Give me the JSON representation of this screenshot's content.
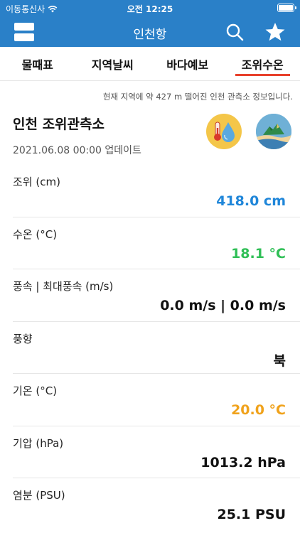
{
  "status_bar": {
    "carrier": "이동통신사",
    "time": "오전 12:25"
  },
  "nav": {
    "title": "인천항"
  },
  "tabs": [
    {
      "label": "물때표",
      "active": false
    },
    {
      "label": "지역날씨",
      "active": false
    },
    {
      "label": "바다예보",
      "active": false
    },
    {
      "label": "조위수온",
      "active": true
    }
  ],
  "notice": "현재 지역에 약 427 m 떨어진 인천 관측소 정보입니다.",
  "station": {
    "name": "인천 조위관측소",
    "updated": "2021.06.08 00:00 업데이트"
  },
  "rows": [
    {
      "label": "조위 (cm)",
      "value": "418.0 cm",
      "color": "#1f86d9"
    },
    {
      "label": "수온 (°C)",
      "value": "18.1 °C",
      "color": "#2fbf56"
    },
    {
      "label": "풍속 | 최대풍속 (m/s)",
      "value": "0.0 m/s | 0.0 m/s",
      "color": "#111111"
    },
    {
      "label": "풍향",
      "value": "북",
      "color": "#111111"
    },
    {
      "label": "기온 (°C)",
      "value": "20.0 °C",
      "color": "#f0a21b"
    },
    {
      "label": "기압 (hPa)",
      "value": "1013.2 hPa",
      "color": "#111111"
    },
    {
      "label": "염분 (PSU)",
      "value": "25.1 PSU",
      "color": "#111111"
    }
  ],
  "icons": {
    "menu": "menu-icon",
    "search": "search-icon",
    "favorite": "star-icon",
    "water_temp": "thermometer-water-icon",
    "station": "island-icon",
    "wifi": "wifi-icon",
    "battery": "battery-icon"
  },
  "colors": {
    "header": "#2a80c8",
    "tab_indicator": "#e8412c"
  }
}
